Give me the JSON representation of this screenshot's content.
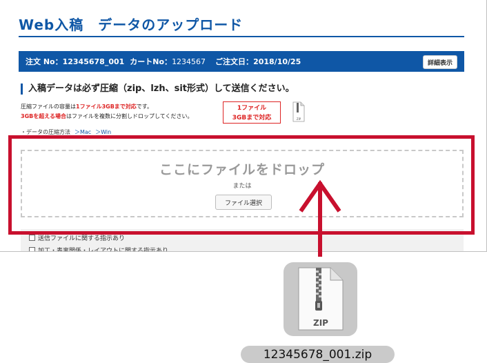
{
  "header": {
    "title": "Web入稿　データのアップロード"
  },
  "order": {
    "order_no_label": "注文 No：",
    "order_no_value": "12345678_001",
    "cart_no_label": "カートNo：",
    "cart_no_value": "1234567",
    "order_date_label": "ご注文日：",
    "order_date_value": "2018/10/25",
    "detail_button": "詳細表示"
  },
  "section": {
    "heading": "入稿データは必ず圧縮（zip、lzh、sit形式）して送信ください。",
    "note1_prefix": "圧縮ファイルの容量は",
    "note1_highlight": "1ファイル3GBまで対応",
    "note1_suffix": "です。",
    "note2_highlight": "3GBを超える場合",
    "note2_suffix": "はファイルを複数に分割しドロップしてください。",
    "badge_line1": "1ファイル",
    "badge_line2": "3GBまで対応",
    "mini_file_label": "ZIP",
    "links_label": "・データの圧縮方法",
    "link_mac": "＞Mac",
    "link_win": "＞Win"
  },
  "dropzone": {
    "main_text": "ここにファイルをドロップ",
    "or_text": "または",
    "select_button": "ファイル選択"
  },
  "options": {
    "item1": "送信ファイルに関する指示あり",
    "item2": "加工・表裏関係・レイアウトに関する指示あり"
  },
  "dragged_file": {
    "icon_label": "ZIP",
    "file_name": "12345678_001.zip"
  },
  "colors": {
    "brand_blue": "#0f57a6",
    "alert_red": "#dd2222",
    "highlight_red": "#c8102e"
  }
}
